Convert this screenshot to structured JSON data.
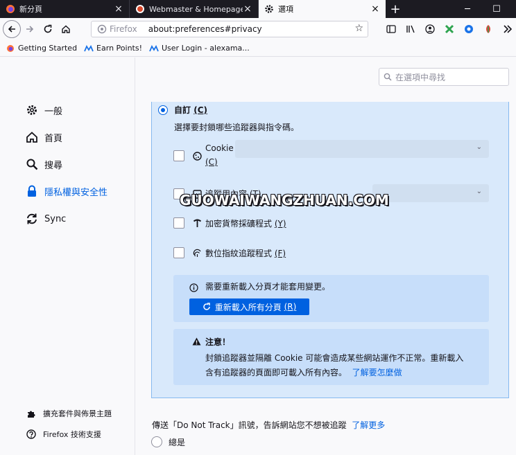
{
  "tabs": [
    {
      "label": "新分頁",
      "active": false
    },
    {
      "label": "Webmaster & Homepages | Ea",
      "active": false
    },
    {
      "label": "選項",
      "active": true
    }
  ],
  "window": {
    "new_tab": "+",
    "minimize": "─",
    "maximize": "☐"
  },
  "urlbar": {
    "brand": "Firefox",
    "url": "about:preferences#privacy"
  },
  "bookmarks": [
    "Getting Started",
    "Earn Points!",
    "User Login - alexama..."
  ],
  "sidebar": {
    "categories": [
      {
        "label": "一般",
        "icon": "gear-icon"
      },
      {
        "label": "首頁",
        "icon": "home-icon"
      },
      {
        "label": "搜尋",
        "icon": "search-icon"
      },
      {
        "label": "隱私權與安全性",
        "icon": "lock-icon",
        "active": true
      },
      {
        "label": "Sync",
        "icon": "sync-icon"
      }
    ],
    "footer": [
      {
        "label": "擴充套件與佈景主題",
        "icon": "puzzle-icon"
      },
      {
        "label": "Firefox 技術支援",
        "icon": "help-icon"
      }
    ]
  },
  "search": {
    "placeholder": "在選項中尋找"
  },
  "custom": {
    "radio_label": "自訂",
    "radio_key": "(C)",
    "description": "選擇要封鎖哪些追蹤器與指令碼。",
    "options": {
      "cookie": {
        "label": "Cookie",
        "key": "(C)"
      },
      "tracking": {
        "label": "追蹤用內容",
        "key": "(T)"
      },
      "crypto": {
        "label": "加密貨幣採礦程式",
        "key": "(Y)"
      },
      "fingerprint": {
        "label": "數位指紋追蹤程式",
        "key": "(F)"
      }
    },
    "info": {
      "text": "需要重新載入分頁才能套用變更。",
      "button": "重新載入所有分頁",
      "button_key": "(R)"
    },
    "warning": {
      "title": "注意！",
      "line1": "封鎖追蹤器並隔離 Cookie 可能會造成某些網站運作不正常。重新載入",
      "line2": "含有追蹤器的頁面即可載入所有內容。",
      "link": "了解要怎麼做"
    }
  },
  "dnt": {
    "text": "傳送「Do Not Track」訊號，告訴網站您不想被追蹤",
    "link": "了解更多",
    "option_always": "總是"
  },
  "watermark": "GUOWAIWANGZHUAN.COM",
  "colors": {
    "accent": "#0061e0",
    "panel": "#d9e9fb",
    "tabstrip": "#1c1b22"
  }
}
